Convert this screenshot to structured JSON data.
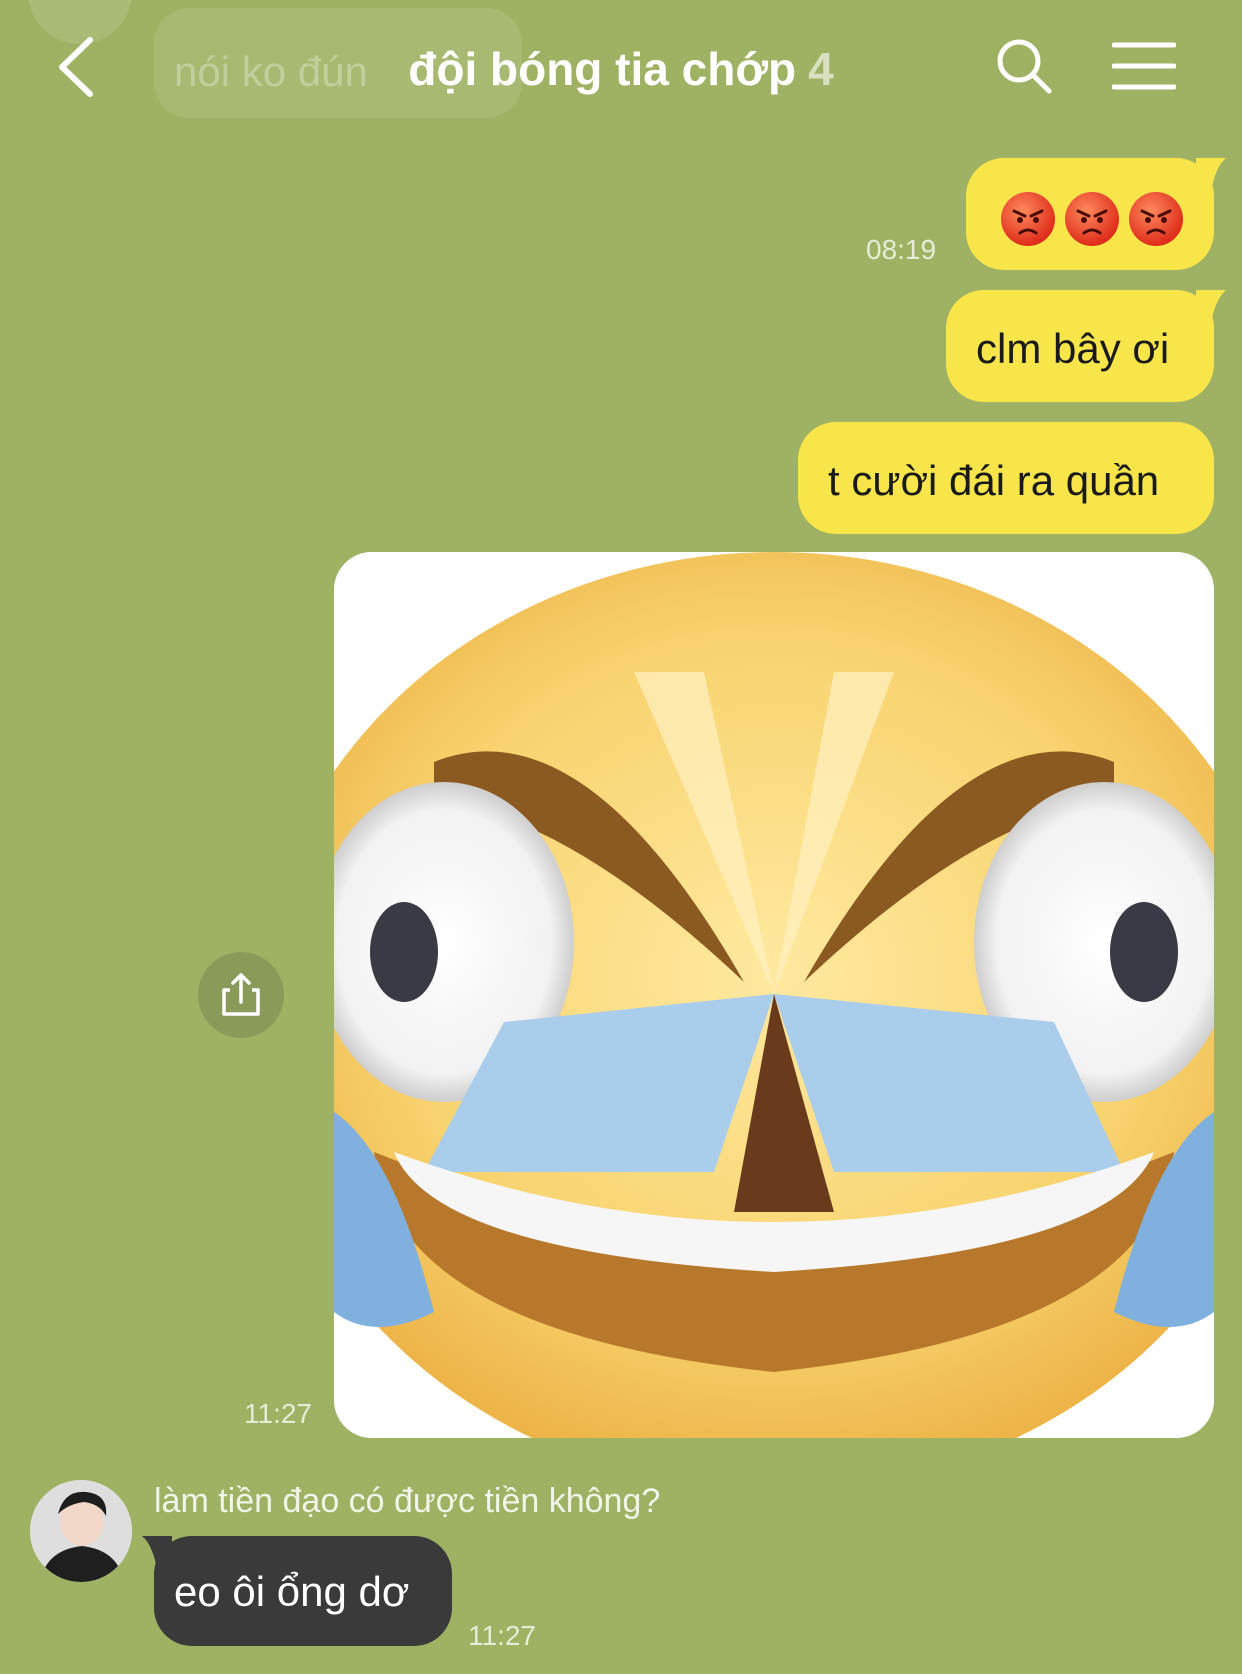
{
  "header": {
    "title": "đội bóng tia chớp",
    "member_count": "4"
  },
  "background_partial": {
    "text": "nói ko đún"
  },
  "messages": [
    {
      "side": "out",
      "kind": "emoji",
      "emoji": [
        "angry-face",
        "angry-face",
        "angry-face"
      ],
      "time": "08:19"
    },
    {
      "side": "out",
      "kind": "text",
      "text": "clm bây ơi"
    },
    {
      "side": "out",
      "kind": "text",
      "text": "t cười đái ra quần"
    },
    {
      "side": "out",
      "kind": "image",
      "image": "distorted-laughing-crying-emoji",
      "time": "11:27"
    },
    {
      "side": "in",
      "kind": "text",
      "sender": "làm tiền đạo có được tiền không?",
      "text": "eo ôi ổng dơ",
      "time": "11:27"
    }
  ],
  "colors": {
    "background": "#9fb263",
    "outgoing_bubble": "#f7e54a",
    "incoming_bubble": "#3a3a3a"
  },
  "icons": [
    "back-icon",
    "search-icon",
    "menu-icon",
    "share-icon"
  ]
}
